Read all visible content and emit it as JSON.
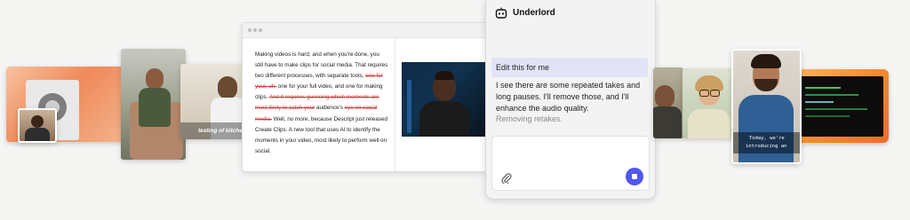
{
  "doc": {
    "p1": "Making videos is hard, and when you're done, you still have to make clips for social media. That requires two different processes, with separate tools,",
    "strike1": "one for your, uh,",
    "p2": "one for your full video, and one for making clips.",
    "strike2": "And it requires guessing which moments are most likely to catch your",
    "p3": "audience's",
    "strike3": "eye on social media.",
    "p4": "Well, no more, because Descript just released Create Clips. A new tool that uses AI to identify the moments in your video, most likely to perform well on social."
  },
  "chat": {
    "title": "Underlord",
    "user_message": "Edit this for me",
    "assistant_message": "I see there are some repeated takes and long pauses. I'll remove those, and I'll enhance the audio quality.",
    "status": "Removing retakes."
  },
  "captions": {
    "left_clip": "testing of kitche",
    "right_clip_line1": "Today, we're",
    "right_clip_line2": "introducing an"
  },
  "colors": {
    "accent": "#5057f0",
    "strike": "#d23a3a",
    "user_bubble": "#e3e3f7"
  },
  "icons": {
    "bot": "robot-icon",
    "attach": "paperclip-icon",
    "stop": "stop-icon"
  }
}
